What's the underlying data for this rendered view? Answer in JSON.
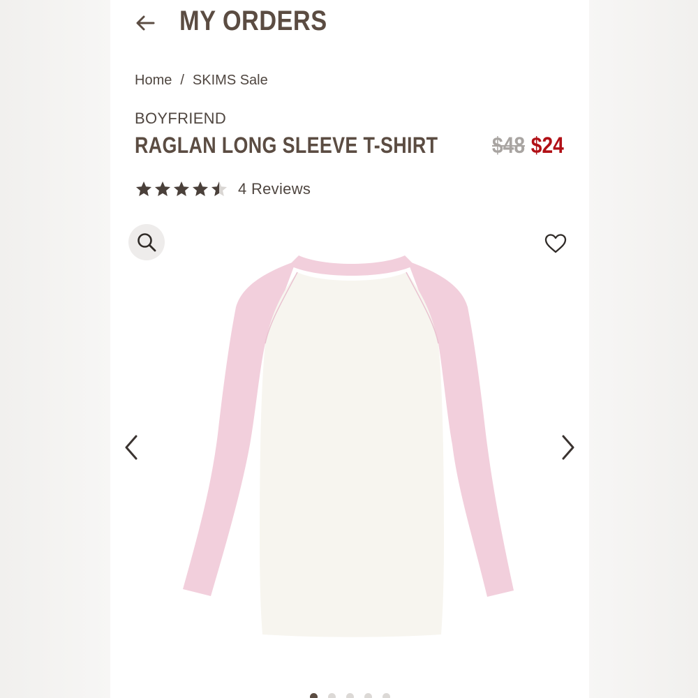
{
  "header": {
    "title": "MY ORDERS",
    "back_icon": "arrow-left-icon"
  },
  "breadcrumb": {
    "items": [
      "Home",
      "SKIMS Sale"
    ],
    "separator": "/"
  },
  "product": {
    "brand_line": "BOYFRIEND",
    "name": "RAGLAN LONG SLEEVE T-SHIRT",
    "price_original": "$48",
    "price_sale": "$24",
    "rating_value": 4.5,
    "rating_max": 5,
    "reviews_label": "4 Reviews",
    "body_color": "#f7f5ef",
    "sleeve_color": "#f2cfdc"
  },
  "gallery": {
    "zoom_icon": "search-icon",
    "favorite_icon": "heart-icon",
    "prev_icon": "chevron-left-icon",
    "next_icon": "chevron-right-icon",
    "image_count": 5,
    "active_index": 0
  },
  "colors": {
    "title": "#5b4c42",
    "text": "#4f4640",
    "sale_price": "#b11016",
    "original_price": "#a8a4a1"
  }
}
